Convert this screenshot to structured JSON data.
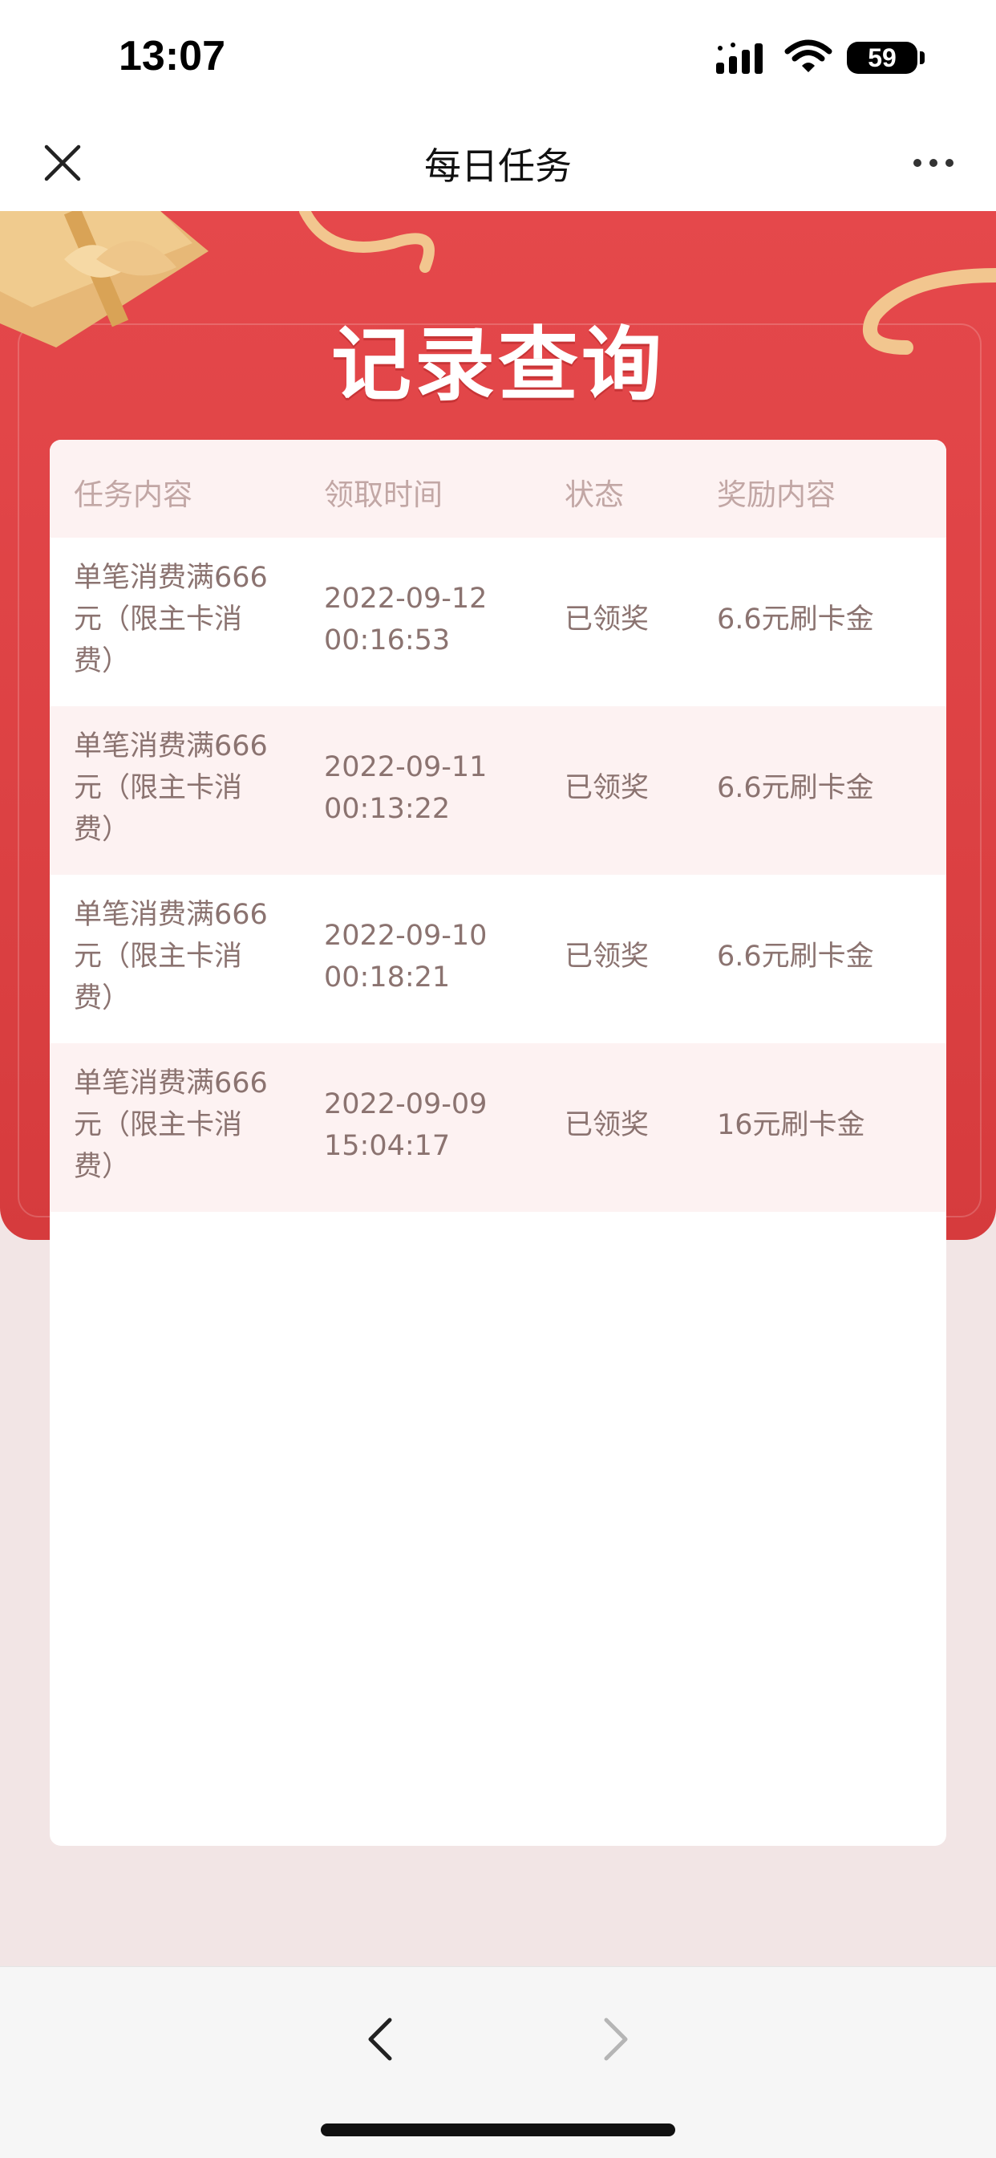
{
  "status_bar": {
    "time": "13:07",
    "battery": "59"
  },
  "nav": {
    "title": "每日任务",
    "close_icon": "close-icon",
    "more_icon": "more-icon"
  },
  "banner": {
    "title": "记录查询"
  },
  "table": {
    "headers": [
      "任务内容",
      "领取时间",
      "状态",
      "奖励内容"
    ],
    "rows": [
      {
        "task": [
          "单笔消费满666",
          "元（限主卡消",
          "费）"
        ],
        "time": [
          "2022-09-12",
          "00:16:53"
        ],
        "status": "已领奖",
        "reward": "6.6元刷卡金"
      },
      {
        "task": [
          "单笔消费满666",
          "元（限主卡消",
          "费）"
        ],
        "time": [
          "2022-09-11",
          "00:13:22"
        ],
        "status": "已领奖",
        "reward": "6.6元刷卡金"
      },
      {
        "task": [
          "单笔消费满666",
          "元（限主卡消",
          "费）"
        ],
        "time": [
          "2022-09-10",
          "00:18:21"
        ],
        "status": "已领奖",
        "reward": "6.6元刷卡金"
      },
      {
        "task": [
          "单笔消费满666",
          "元（限主卡消",
          "费）"
        ],
        "time": [
          "2022-09-09",
          "15:04:17"
        ],
        "status": "已领奖",
        "reward": "16元刷卡金"
      }
    ]
  },
  "colors": {
    "banner_red": "#e5484b",
    "row_alt": "#fdf2f2",
    "text_muted": "#8b7370",
    "header_text": "#c2a7a5"
  },
  "toolbar": {
    "back_icon": "chevron-left-icon",
    "forward_icon": "chevron-right-icon"
  }
}
